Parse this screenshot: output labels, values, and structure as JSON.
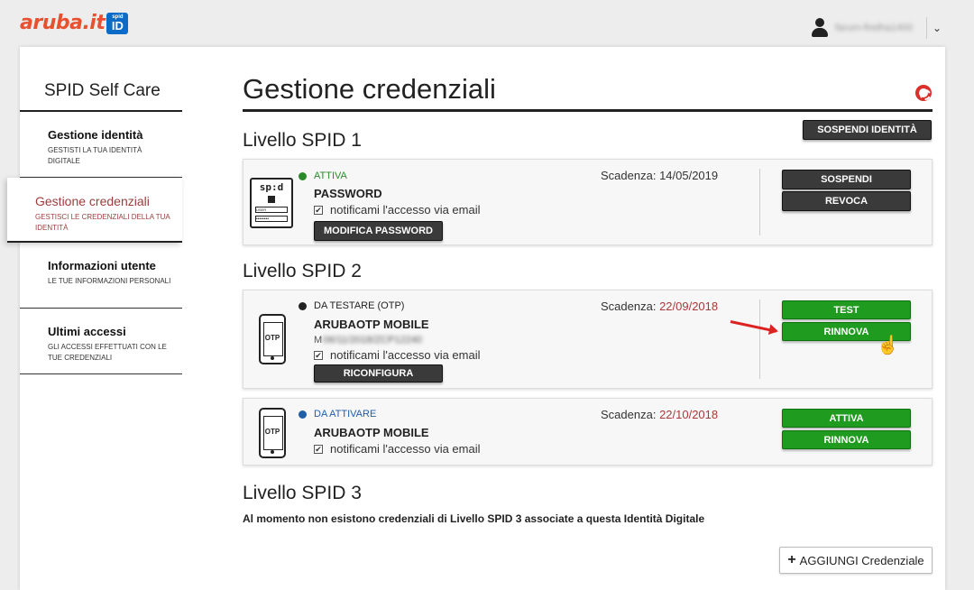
{
  "header": {
    "logo_text": "aruba.it",
    "logo_badge_top": "spid",
    "logo_badge_bottom": "ID",
    "user_name": "farum-firelha1400",
    "colors": {
      "brand": "#e8502f",
      "badge": "#0b6bc6"
    }
  },
  "sidebar": {
    "title": "SPID Self Care",
    "items": [
      {
        "title": "Gestione identità",
        "subtitle": "GESTISTI LA TUA IDENTITÀ DIGITALE"
      },
      {
        "title": "Gestione credenziali",
        "subtitle": "GESTISCI LE CREDENZIALI DELLA TUA IDENTITÀ"
      },
      {
        "title": "Informazioni utente",
        "subtitle": "LE TUE INFORMAZIONI PERSONALI"
      },
      {
        "title": "Ultimi accessi",
        "subtitle": "GLI ACCESSI EFFETTUATI CON LE TUE CREDENZIALI"
      }
    ]
  },
  "main": {
    "title": "Gestione credenziali",
    "suspend_identity_label": "SOSPENDI IDENTITÀ",
    "level1": {
      "title": "Livello SPID 1",
      "cred": {
        "icon_label": "sp:d",
        "field_user": "USER",
        "field_pass": "••••••••",
        "status": "ATTIVA",
        "status_color": "#2a8a2a",
        "name": "PASSWORD",
        "notify": "notificami l'accesso via email",
        "expiry_label": "Scadenza:",
        "expiry_date": "14/05/2019",
        "action_label": "MODIFICA PASSWORD",
        "btn1": "SOSPENDI",
        "btn2": "REVOCA"
      }
    },
    "level2": {
      "title": "Livello SPID 2",
      "cred1": {
        "icon_label": "OTP",
        "status": "DA TESTARE (OTP)",
        "status_color": "#222222",
        "name": "ARUBAOTP MOBILE",
        "device_prefix": "M",
        "device_blurred": "06/11/2018/ZCP12240",
        "notify": "notificami l'accesso via email",
        "expiry_label": "Scadenza:",
        "expiry_date": "22/09/2018",
        "action_label": "RICONFIGURA",
        "btn1": "TEST",
        "btn2": "RINNOVA"
      },
      "cred2": {
        "icon_label": "OTP",
        "status": "DA ATTIVARE",
        "status_color": "#1f5fa8",
        "name": "ARUBAOTP MOBILE",
        "notify": "notificami l'accesso via email",
        "expiry_label": "Scadenza:",
        "expiry_date": "22/10/2018",
        "btn1": "ATTIVA",
        "btn2": "RINNOVA"
      }
    },
    "level3": {
      "title": "Livello SPID 3",
      "text": "Al momento non esistono credenziali di Livello SPID 3 associate a questa Identità Digitale"
    },
    "add_button_label": "AGGIUNGI Credenziale"
  }
}
